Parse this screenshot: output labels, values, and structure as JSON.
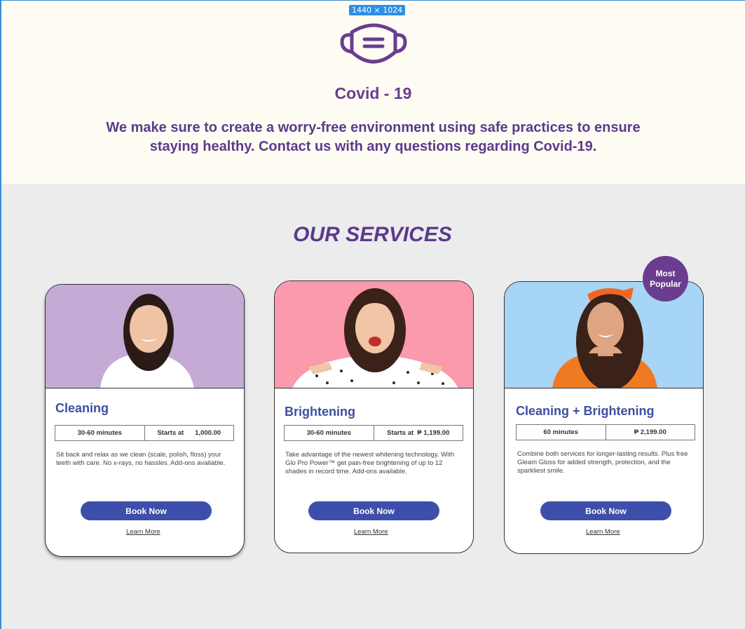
{
  "canvas": {
    "size_label": "1440 × 1024"
  },
  "covid": {
    "icon": "face-mask-icon",
    "title": "Covid - 19",
    "line1": "We make sure to create  a worry-free environment using safe practices to ensure",
    "line2": "staying healthy. Contact us with any questions regarding Covid-19."
  },
  "services": {
    "title": "OUR SERVICES",
    "badge_line1": "Most",
    "badge_line2": "Popular",
    "cards": [
      {
        "photo_bg": "#c4aad4",
        "title": "Cleaning",
        "duration": "30-60 minutes",
        "price": "Starts at      1,000.00",
        "desc": "Sit back and relax as we clean (scale, polish, floss) your teeth with care. No x-rays, no hassles. Add-ons available.",
        "book": "Book Now",
        "learn": "Learn More"
      },
      {
        "photo_bg": "#fa9aac",
        "title": "Brightening",
        "duration": "30-60 minutes",
        "price": "Starts at  ₱ 1,199.00",
        "desc": "Take advantage of the newest whitening technology. With Glo Pro Power™ get pain-free brightening of up to 12 shades in record time. Add-ons available.",
        "book": "Book Now",
        "learn": "Learn More"
      },
      {
        "photo_bg": "#a7d5f5",
        "title": "Cleaning + Brightening",
        "duration": "60 minutes",
        "price": "₱ 2,199.00",
        "desc": "Combine both services for longer-lasting results. Plus free Gleam Gloss for added strength, protection, and the sparkliest smile.",
        "book": "Book Now",
        "learn": "Learn More"
      }
    ]
  },
  "colors": {
    "purple": "#5b3a8c",
    "blue": "#3d4fab",
    "cream": "#fffcf4",
    "gray": "#ececed"
  }
}
